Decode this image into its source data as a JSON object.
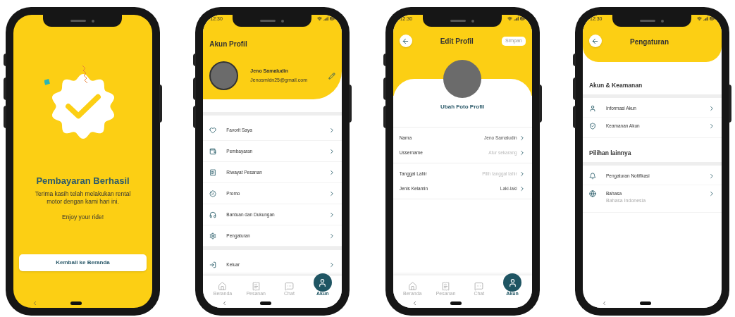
{
  "screens": [
    {
      "kind": "success",
      "title": "Pembayaran Berhasil",
      "message": "Terima kasih telah melakukan rental motor dengan kami hari ini.",
      "note": "Enjoy your ride!",
      "button": "Kembali ke Beranda"
    },
    {
      "kind": "profile",
      "status_time": "12:30",
      "title": "Akun Profil",
      "user": {
        "name": "Jeno Samaludin",
        "email": "Jenosmldn25@gmail.com"
      },
      "menu_groups": [
        [
          "Favorit Saya",
          "Pembayaran",
          "Riwayat Pesanan",
          "Promo",
          "Bantuan dan Dukungan",
          "Pengaturan"
        ],
        [
          "Keluar"
        ]
      ],
      "nav": [
        {
          "label": "Beranda",
          "selected": false
        },
        {
          "label": "Pesanan",
          "selected": false
        },
        {
          "label": "Chat",
          "selected": false
        },
        {
          "label": "Akun",
          "selected": true
        }
      ]
    },
    {
      "kind": "edit",
      "status_time": "12:30",
      "title": "Edit Profil",
      "save": "Simpan",
      "change_photo": "Ubah Foto Profil",
      "field_groups": [
        [
          {
            "label": "Nama",
            "value": "Jeno Samaludin"
          },
          {
            "label": "Ussername",
            "placeholder": "Atur sekarang"
          }
        ],
        [
          {
            "label": "Tanggal Lahir",
            "placeholder": "Pilih tanggal lahir"
          },
          {
            "label": "Jenis Kelamin",
            "value": "Laki-laki"
          }
        ]
      ],
      "nav": [
        {
          "label": "Beranda",
          "selected": false
        },
        {
          "label": "Pesanan",
          "selected": false
        },
        {
          "label": "Chat",
          "selected": false
        },
        {
          "label": "Akun",
          "selected": true
        }
      ]
    },
    {
      "kind": "settings",
      "status_time": "12:30",
      "title": "Pengaturan",
      "sections": [
        {
          "heading": "Akun & Keamanan",
          "items": [
            {
              "label": "Informasi Akun"
            },
            {
              "label": "Keamanan Akun"
            }
          ]
        },
        {
          "heading": "Pilihan lainnya",
          "items": [
            {
              "label": "Pengaturan Notifikasi"
            },
            {
              "label": "Bahasa",
              "sublabel": "Bahasa Indonesia"
            }
          ]
        }
      ]
    }
  ]
}
